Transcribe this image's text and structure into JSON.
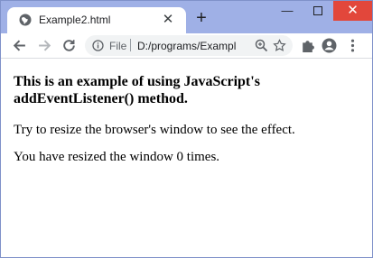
{
  "browser": {
    "tab": {
      "title": "Example2.html",
      "favicon": "globe-icon",
      "close_glyph": "✕"
    },
    "new_tab_glyph": "+",
    "window_controls": {
      "minimize_glyph": "—",
      "close_glyph": "✕",
      "close_color": "#e2473b"
    },
    "toolbar": {
      "back_icon": "back-arrow-icon",
      "forward_icon": "forward-arrow-icon",
      "reload_icon": "reload-icon",
      "extensions_icon": "puzzle-icon",
      "profile_icon": "account-icon",
      "menu_icon": "more-vertical-icon"
    },
    "omnibox": {
      "scheme_label": "File",
      "url": "D:/programs/Exampl",
      "info_icon": "info-icon",
      "zoom_icon": "zoom-icon",
      "bookmark_icon": "star-icon"
    }
  },
  "page": {
    "heading": "This is an example of using JavaScript's addEventListener() method.",
    "instruction": "Try to resize the browser's window to see the effect.",
    "status": "You have resized the window 0 times."
  }
}
